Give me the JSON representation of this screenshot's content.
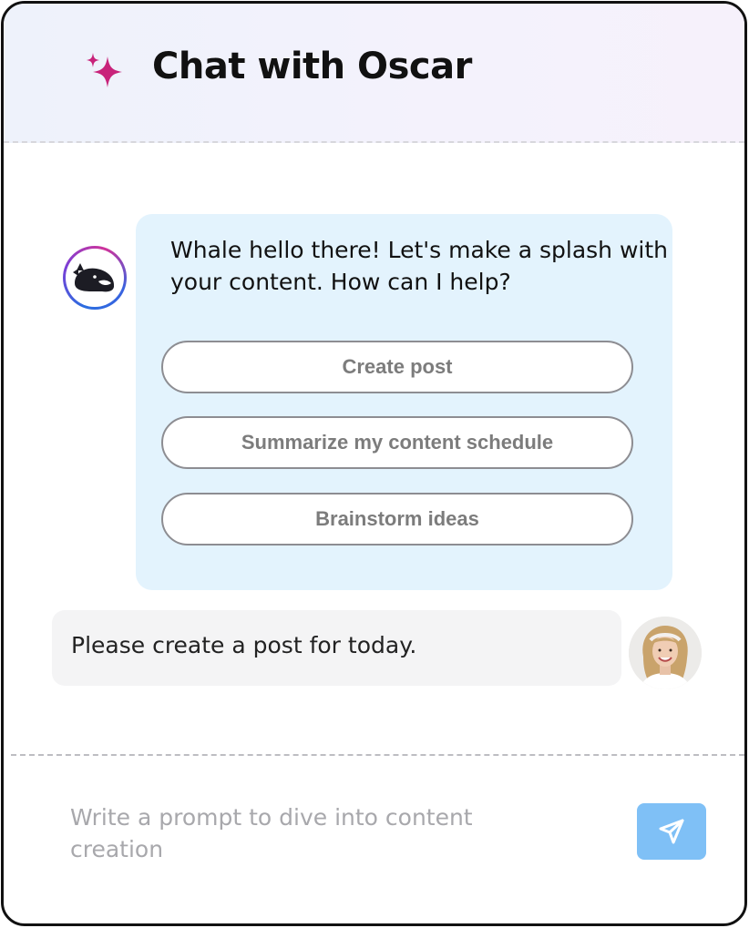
{
  "header": {
    "title": "Chat with Oscar",
    "icon": "sparkle-icon",
    "icon_color": "#c8237a"
  },
  "conversation": {
    "bot_message": {
      "avatar": "whale-avatar",
      "text": "Whale hello there! Let's make a splash with your content. How can I help?",
      "suggestions": [
        {
          "label": "Create post"
        },
        {
          "label": "Summarize my content schedule"
        },
        {
          "label": "Brainstorm ideas"
        }
      ]
    },
    "user_message": {
      "avatar": "user-avatar",
      "text": "Please create a post for today."
    }
  },
  "composer": {
    "placeholder": "Write a prompt to dive into content creation",
    "value": "",
    "send_icon": "send-icon"
  },
  "colors": {
    "bot_bubble": "#e3f3fd",
    "user_bubble": "#f4f4f5",
    "send_button": "#7fc0f6",
    "accent": "#c8237a"
  }
}
